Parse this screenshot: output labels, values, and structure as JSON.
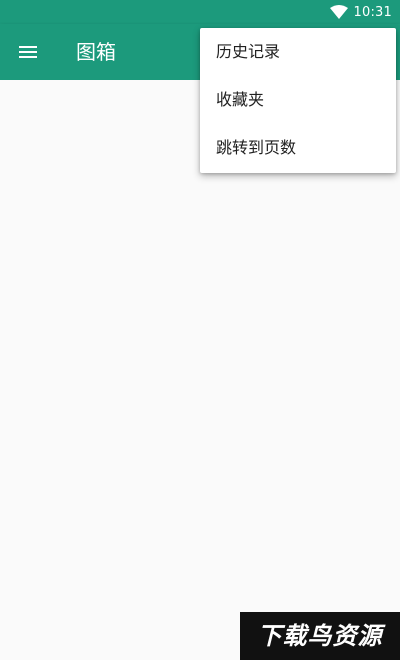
{
  "status_bar": {
    "time": "10:31",
    "wifi_icon": "wifi-icon",
    "background": "#1c9a7c"
  },
  "app_bar": {
    "title": "图箱",
    "menu_icon": "hamburger-menu-icon",
    "background": "#1c9a7c"
  },
  "overflow_menu": {
    "items": [
      {
        "label": "历史记录"
      },
      {
        "label": "收藏夹"
      },
      {
        "label": "跳转到页数"
      }
    ]
  },
  "watermark": {
    "text": "下载鸟资源"
  }
}
